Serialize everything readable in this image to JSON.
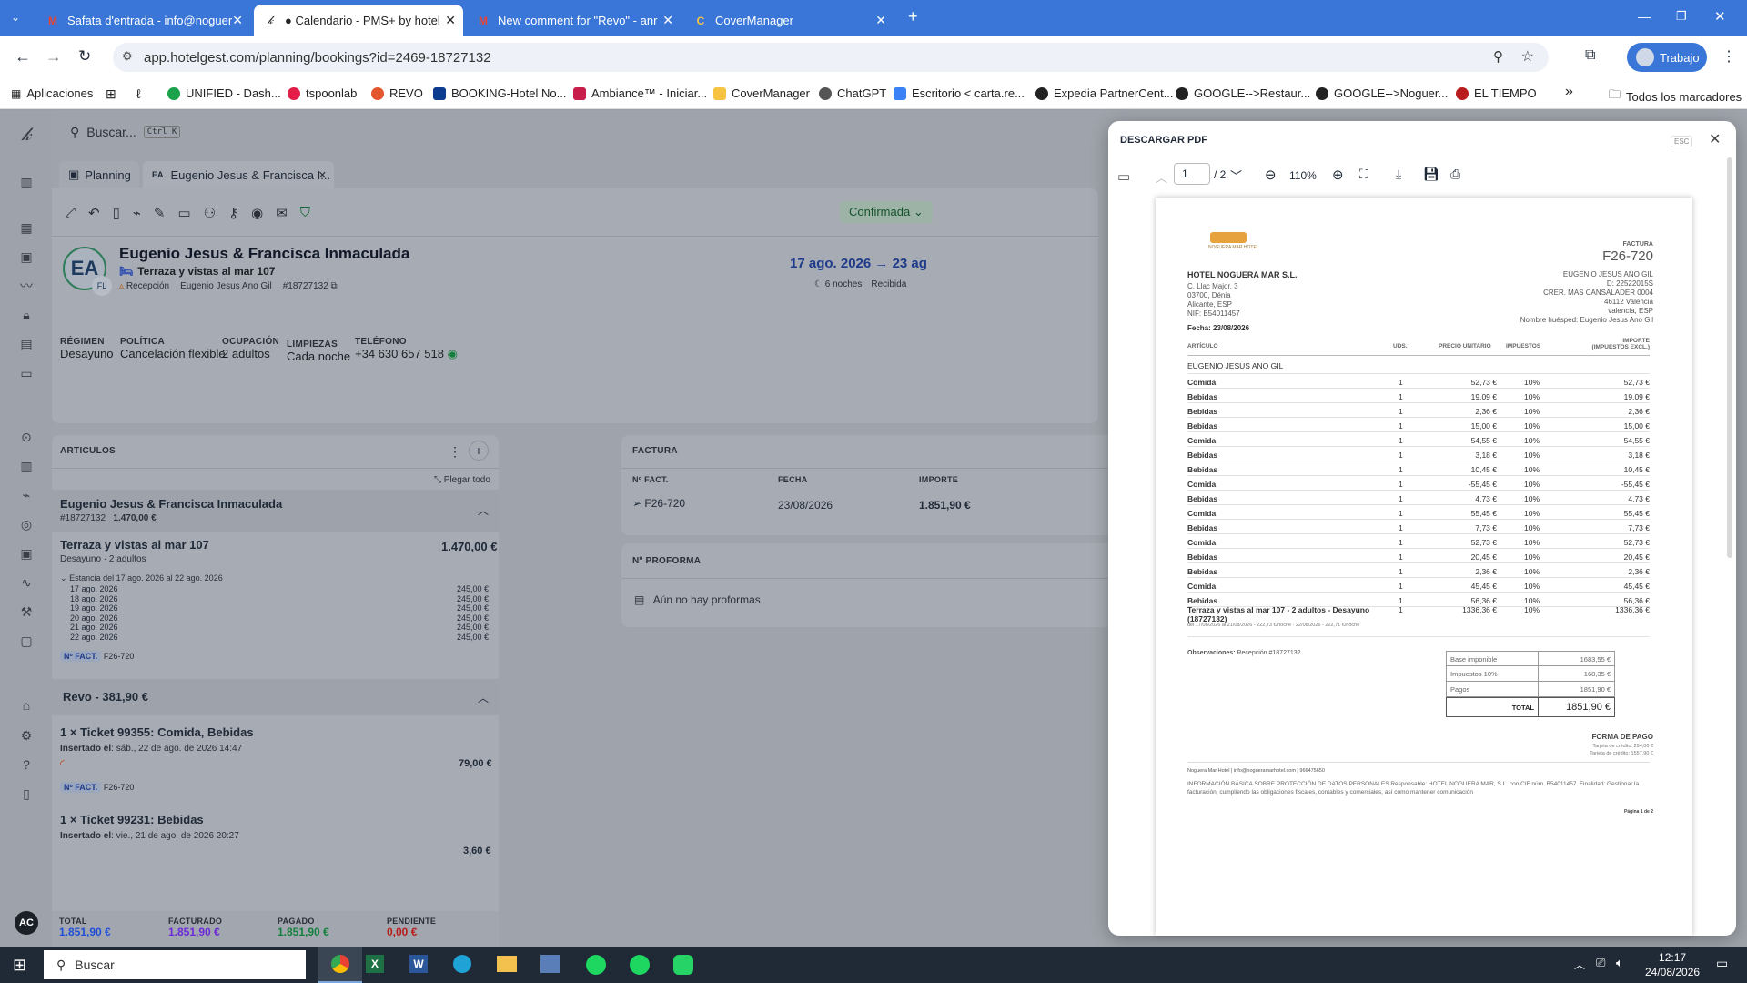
{
  "browser": {
    "tabs": [
      {
        "label": "Safata d'entrada - info@noguer",
        "icon": "gmail-icon"
      },
      {
        "label": "● Calendario - PMS+ by hotelge",
        "icon": "hotelgest-icon",
        "active": true
      },
      {
        "label": "New comment for \"Revo\" - anr",
        "icon": "gmail-icon"
      },
      {
        "label": "CoverManager",
        "icon": "covermanager-icon"
      }
    ],
    "url": "app.hotelgest.com/planning/bookings?id=2469-18727132",
    "profile": "Trabajo",
    "bookmarks": [
      "Aplicaciones",
      "UNIFIED - Dash...",
      "tspoonlab",
      "REVO",
      "BOOKING-Hotel No...",
      "Ambiance™ - Iniciar...",
      "CoverManager",
      "ChatGPT",
      "Escritorio < carta.re...",
      "Expedia PartnerCent...",
      "GOOGLE-->Restaur...",
      "GOOGLE-->Noguer...",
      "EL TIEMPO"
    ],
    "all_bookmarks": "Todos los marcadores"
  },
  "app": {
    "search_placeholder": "Buscar...",
    "search_shortcut": "Ctrl K",
    "tabs": [
      "Planning",
      "Eugenio Jesus & Francisca I..."
    ],
    "tab_badge": "EA",
    "status": "Confirmada",
    "avatar": "EA",
    "avatar_sub": "FL",
    "guest_name": "Eugenio Jesus & Francisca Inmaculada",
    "room": "Terraza y vistas al mar 107",
    "source": "Recepción",
    "holder": "Eugenio Jesus Ano Gil",
    "booking_id": "#18727132",
    "date_from": "17 ago. 2026",
    "date_to": "23 ag",
    "nights": "6 noches",
    "received": "Recibida",
    "info": [
      {
        "label": "RÉGIMEN",
        "value": "Desayuno"
      },
      {
        "label": "POLÍTICA",
        "value": "Cancelación flexible"
      },
      {
        "label": "OCUPACIÓN",
        "value": "2 adultos"
      },
      {
        "label": "LIMPIEZAS",
        "value": "Cada noche"
      },
      {
        "label": "TELÉFONO",
        "value": "+34 630 657 518"
      }
    ],
    "articulos": {
      "title": "ARTICULOS",
      "collapse": "Plegar todo",
      "group_name": "Eugenio Jesus & Francisca Inmaculada",
      "group_id": "#18727132",
      "group_total": "1.470,00 €",
      "room_title": "Terraza y vistas al mar 107",
      "room_total": "1.470,00 €",
      "room_sub": "Desayuno · 2 adultos",
      "stay": "Estancia del 17 ago. 2026 al 22 ago. 2026",
      "nights": [
        {
          "date": "17 ago. 2026",
          "price": "245,00 €"
        },
        {
          "date": "18 ago. 2026",
          "price": "245,00 €"
        },
        {
          "date": "19 ago. 2026",
          "price": "245,00 €"
        },
        {
          "date": "20 ago. 2026",
          "price": "245,00 €"
        },
        {
          "date": "21 ago. 2026",
          "price": "245,00 €"
        },
        {
          "date": "22 ago. 2026",
          "price": "245,00 €"
        }
      ],
      "nfact_label": "Nº FACT.",
      "nfact": "F26-720",
      "revo_title": "Revo - 381,90 €",
      "ticket1": "1 × Ticket 99355: Comida, Bebidas",
      "ticket1_ins_label": "Insertado el",
      "ticket1_ins": ": sáb., 22 de ago. de 2026 14:47",
      "ticket1_price": "79,00 €",
      "ticket2": "1 × Ticket 99231: Bebidas",
      "ticket2_ins_label": "Insertado el",
      "ticket2_ins": ": vie., 21 de ago. de 2026 20:27",
      "ticket2_price": "3,60 €"
    },
    "totals": [
      {
        "label": "TOTAL",
        "value": "1.851,90 €",
        "color": "#1d4ed8"
      },
      {
        "label": "FACTURADO",
        "value": "1.851,90 €",
        "color": "#6d28d9"
      },
      {
        "label": "PAGADO",
        "value": "1.851,90 €",
        "color": "#15803d"
      },
      {
        "label": "PENDIENTE",
        "value": "0,00 €",
        "color": "#b91c1c"
      }
    ],
    "factura": {
      "title": "FACTURA",
      "headers": [
        "Nº FACT.",
        "FECHA",
        "IMPORTE"
      ],
      "num": "F26-720",
      "date": "23/08/2026",
      "amount": "1.851,90 €"
    },
    "proforma": {
      "title": "Nº PROFORMA",
      "empty": "Aún no hay proformas"
    }
  },
  "pdf": {
    "title": "DESCARGAR PDF",
    "esc": "ESC",
    "page": "1",
    "pages": "/ 2",
    "zoom": "110%",
    "logo": "NOGUERA MAR HOTEL",
    "doc_type": "FACTURA",
    "doc_num": "F26-720",
    "company": "HOTEL NOGUERA MAR S.L.",
    "company_addr": [
      "C. Llac Major, 3",
      "03700, Dénia",
      "Alicante, ESP",
      "NIF: B54011457"
    ],
    "client_addr": [
      "EUGENIO JESUS ANO GIL",
      "D: 22522015S",
      "CRER. MAS CANSALADER 0004",
      "46112 Valencia",
      "valencia, ESP",
      "Nombre huésped: Eugenio Jesus Ano Gil"
    ],
    "fecha": "Fecha: 23/08/2026",
    "headers": [
      "ARTÍCULO",
      "UDS.",
      "PRECIO UNITARIO",
      "IMPUESTOS",
      "IMPORTE (IMPUESTOS EXCL.)"
    ],
    "client_row": "EUGENIO JESUS ANO GIL",
    "rows": [
      {
        "a": "Comida",
        "u": "1",
        "p": "52,73 €",
        "t": "10%",
        "i": "52,73 €"
      },
      {
        "a": "Bebidas",
        "u": "1",
        "p": "19,09 €",
        "t": "10%",
        "i": "19,09 €"
      },
      {
        "a": "Bebidas",
        "u": "1",
        "p": "2,36 €",
        "t": "10%",
        "i": "2,36 €"
      },
      {
        "a": "Bebidas",
        "u": "1",
        "p": "15,00 €",
        "t": "10%",
        "i": "15,00 €"
      },
      {
        "a": "Comida",
        "u": "1",
        "p": "54,55 €",
        "t": "10%",
        "i": "54,55 €"
      },
      {
        "a": "Bebidas",
        "u": "1",
        "p": "3,18 €",
        "t": "10%",
        "i": "3,18 €"
      },
      {
        "a": "Bebidas",
        "u": "1",
        "p": "10,45 €",
        "t": "10%",
        "i": "10,45 €"
      },
      {
        "a": "Comida",
        "u": "1",
        "p": "-55,45 €",
        "t": "10%",
        "i": "-55,45 €"
      },
      {
        "a": "Bebidas",
        "u": "1",
        "p": "4,73 €",
        "t": "10%",
        "i": "4,73 €"
      },
      {
        "a": "Comida",
        "u": "1",
        "p": "55,45 €",
        "t": "10%",
        "i": "55,45 €"
      },
      {
        "a": "Bebidas",
        "u": "1",
        "p": "7,73 €",
        "t": "10%",
        "i": "7,73 €"
      },
      {
        "a": "Comida",
        "u": "1",
        "p": "52,73 €",
        "t": "10%",
        "i": "52,73 €"
      },
      {
        "a": "Bebidas",
        "u": "1",
        "p": "20,45 €",
        "t": "10%",
        "i": "20,45 €"
      },
      {
        "a": "Bebidas",
        "u": "1",
        "p": "2,36 €",
        "t": "10%",
        "i": "2,36 €"
      },
      {
        "a": "Comida",
        "u": "1",
        "p": "45,45 €",
        "t": "10%",
        "i": "45,45 €"
      },
      {
        "a": "Bebidas",
        "u": "1",
        "p": "56,36 €",
        "t": "10%",
        "i": "56,36 €"
      }
    ],
    "room_row": {
      "a": "Terraza y vistas al mar 107 - 2 adultos - Desayuno (18727132)",
      "u": "1",
      "p": "1336,36 €",
      "t": "10%",
      "i": "1336,36 €",
      "detail": "del 17/08/2026 al 21/08/2026 - 222,73 €/noche · 22/08/2026 - 222,71 €/noche"
    },
    "observaciones_label": "Observaciones:",
    "observaciones": "Recepción #18727132",
    "summary": [
      {
        "k": "Base imponible",
        "v": "1683,55 €"
      },
      {
        "k": "Impuestos 10%",
        "v": "168,35 €"
      },
      {
        "k": "Pagos",
        "v": "1851,90 €"
      }
    ],
    "total_label": "TOTAL",
    "total": "1851,90 €",
    "forma_pago": "FORMA DE PAGO",
    "pagos": [
      "Tarjeta de crédito: 294,00 €",
      "Tarjeta de crédito: 1557,90 €"
    ],
    "footer": "Noguera Mar Hotel | info@nogueramarhotel.com | 966475650",
    "legal": "INFORMACIÓN BÁSICA SOBRE PROTECCIÓN DE DATOS PERSONALES Responsable: HOTEL NOGUERA MAR, S.L. con CIF núm. B54011457. Finalidad: Gestionar la facturación, cumpliendo las obligaciones fiscales, contables y comerciales, así como mantener comunicación",
    "page_foot": "Página 1 de 2"
  },
  "taskbar": {
    "search": "Buscar",
    "time": "12:17",
    "date": "24/08/2026"
  },
  "user_initials": "AC"
}
